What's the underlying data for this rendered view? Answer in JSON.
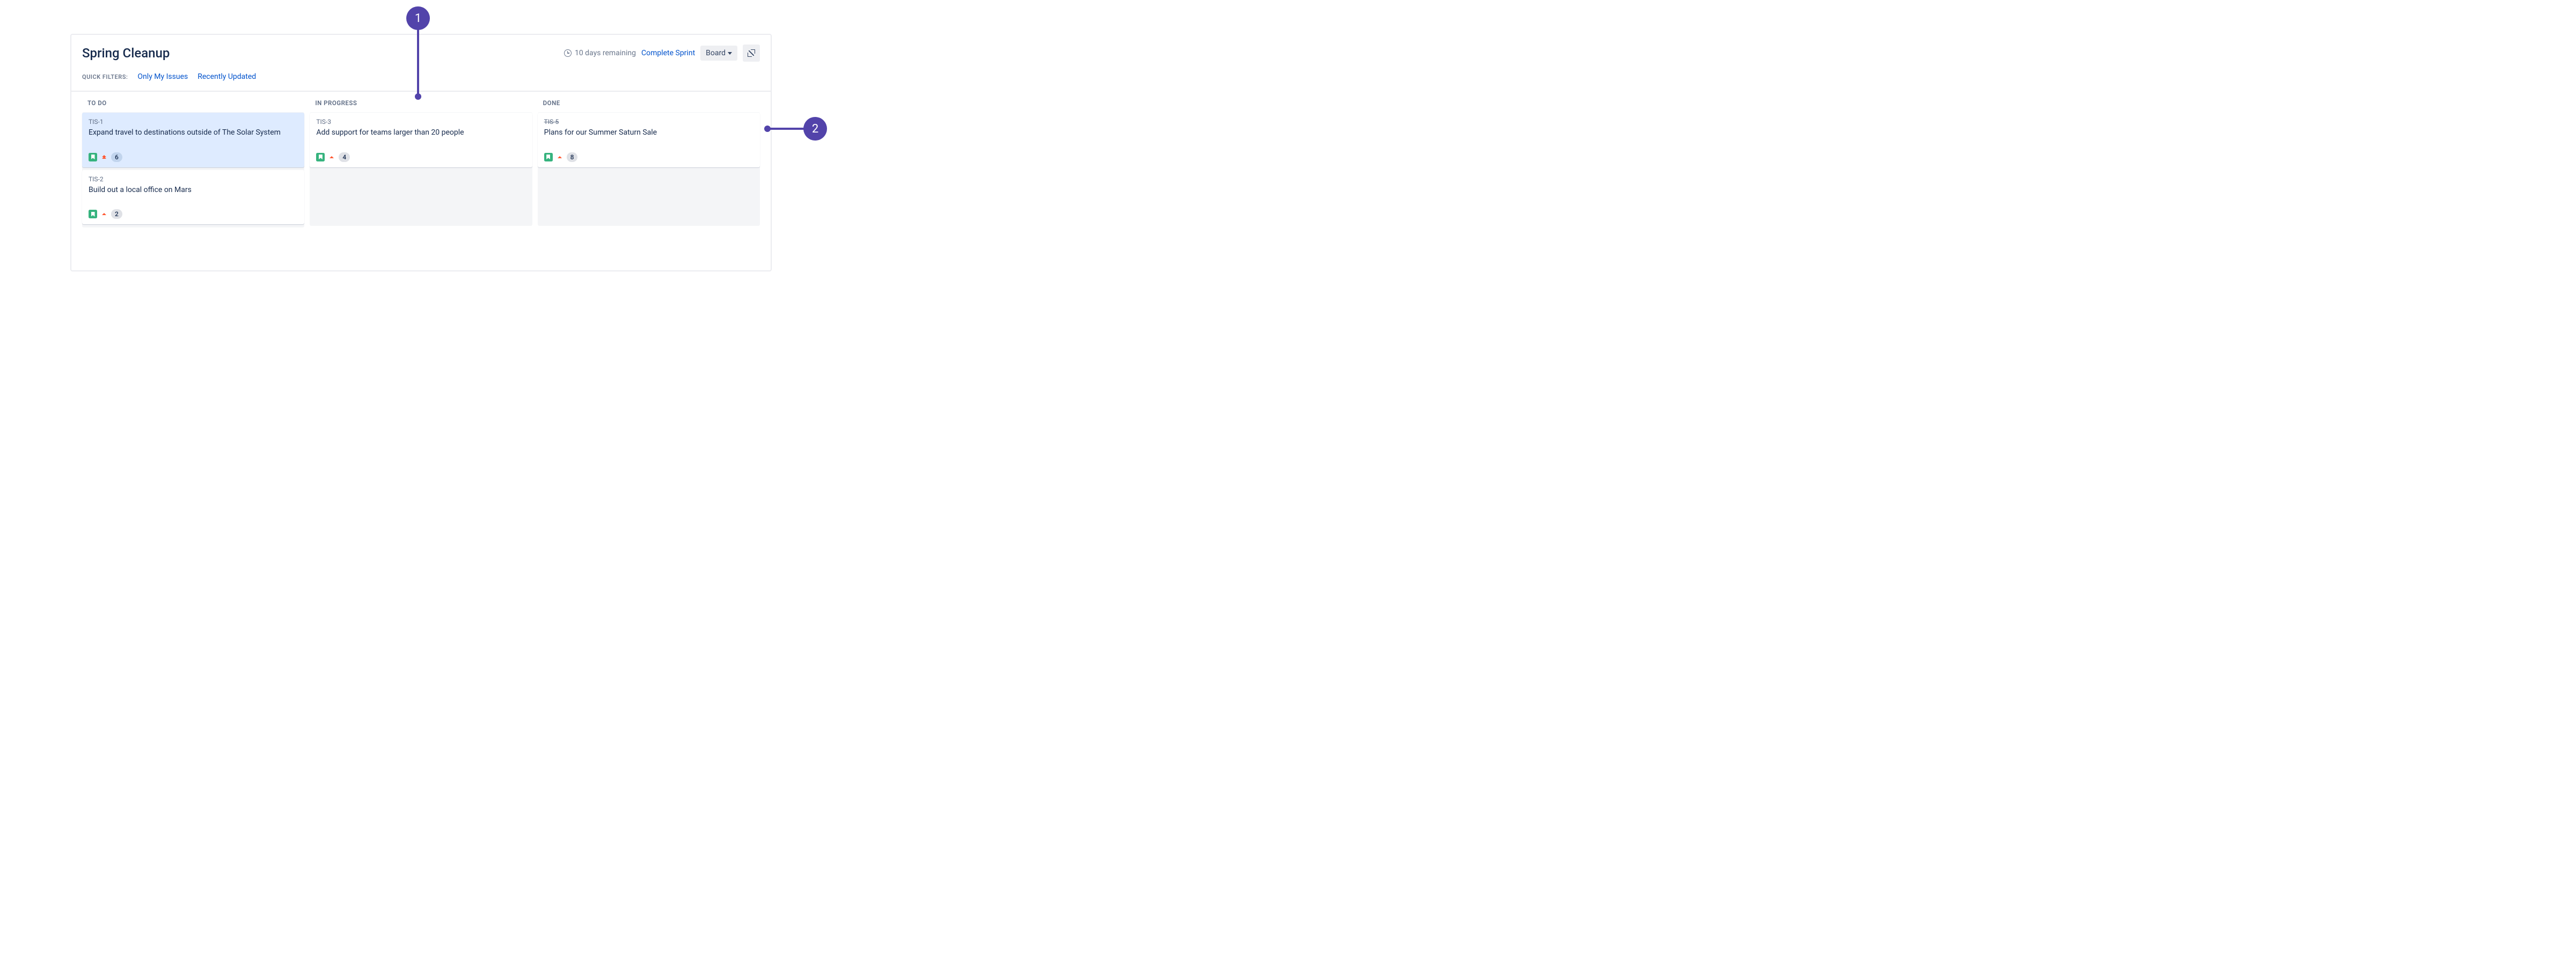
{
  "board": {
    "title": "Spring Cleanup",
    "remaining_text": "10 days remaining",
    "complete_label": "Complete Sprint",
    "view_dropdown_label": "Board"
  },
  "filters": {
    "label": "QUICK FILTERS:",
    "items": [
      "Only My Issues",
      "Recently Updated"
    ]
  },
  "columns": [
    {
      "name": "TO DO",
      "cards": [
        {
          "key": "TIS-1",
          "title": "Expand travel to destinations outside of The Solar System",
          "type": "story",
          "priority": "highest",
          "estimate": "6",
          "selected": true,
          "done": false
        },
        {
          "key": "TIS-2",
          "title": "Build out a local office on Mars",
          "type": "story",
          "priority": "high",
          "estimate": "2",
          "selected": false,
          "done": false
        }
      ]
    },
    {
      "name": "IN PROGRESS",
      "cards": [
        {
          "key": "TIS-3",
          "title": "Add support for teams larger than 20 people",
          "type": "story",
          "priority": "high",
          "estimate": "4",
          "selected": false,
          "done": false
        }
      ]
    },
    {
      "name": "DONE",
      "cards": [
        {
          "key": "TIS-5",
          "title": "Plans for our Summer Saturn Sale",
          "type": "story",
          "priority": "high",
          "estimate": "8",
          "selected": false,
          "done": true
        }
      ]
    }
  ],
  "annotations": {
    "callout1": "1",
    "callout2": "2"
  },
  "colors": {
    "accent": "#0052CC",
    "callout": "#5243AA",
    "story": "#36B37E",
    "priority": "#FF5630"
  }
}
